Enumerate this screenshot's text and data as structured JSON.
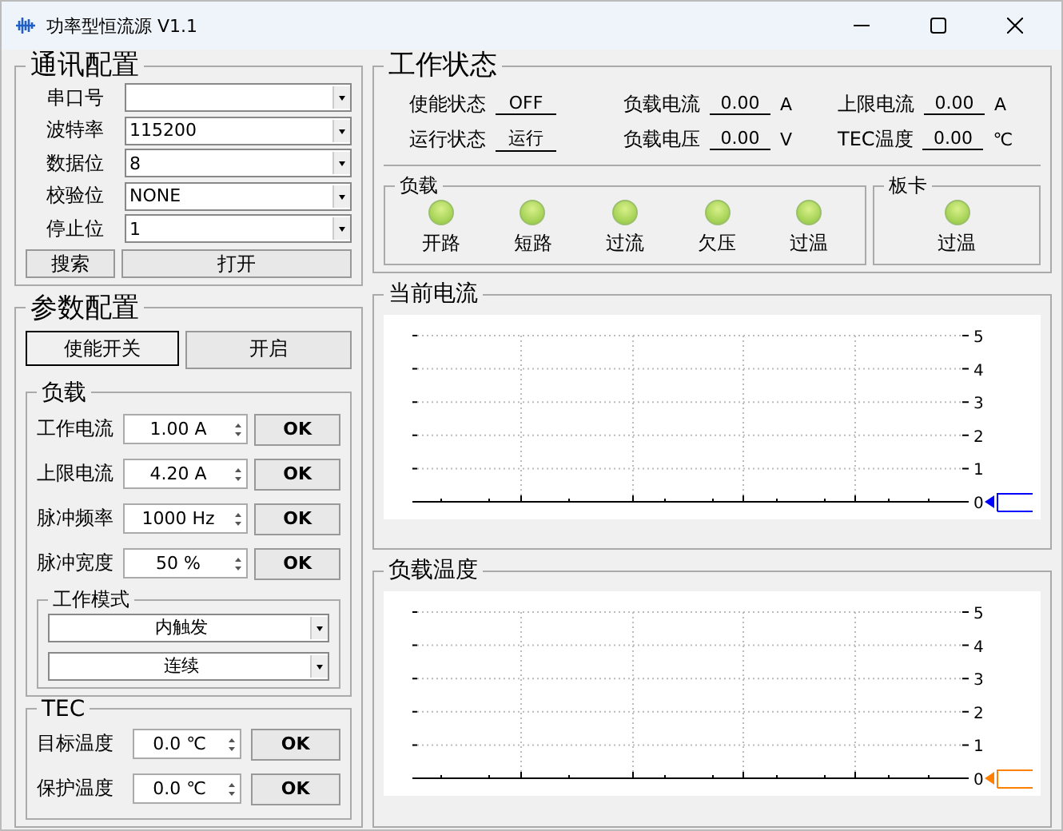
{
  "window": {
    "title": "功率型恒流源 V1.1"
  },
  "comm": {
    "title": "通讯配置",
    "fields": [
      {
        "label": "串口号"
      },
      {
        "label": "波特率",
        "value": "115200"
      },
      {
        "label": "数据位",
        "value": "8"
      },
      {
        "label": "校验位",
        "value": "NONE"
      },
      {
        "label": "停止位",
        "value": "1"
      }
    ],
    "buttons": [
      "搜索",
      "打开"
    ]
  },
  "params": {
    "title": "参数配置",
    "switch_label": "使能开关",
    "switch_button": "开启",
    "load": {
      "title": "负载",
      "rows": [
        {
          "label": "工作电流",
          "value": "1.00 A",
          "button": "OK"
        },
        {
          "label": "上限电流",
          "value": "4.20 A",
          "button": "OK"
        },
        {
          "label": "脉冲频率",
          "value": "1000 Hz",
          "button": "OK"
        },
        {
          "label": "脉冲宽度",
          "value": "50 %",
          "button": "OK"
        }
      ],
      "mode": {
        "title": "工作模式",
        "options": [
          "内触发",
          "连续"
        ]
      }
    },
    "tec": {
      "title": "TEC",
      "rows": [
        {
          "label": "目标温度",
          "value": "0.0 ℃",
          "button": "OK"
        },
        {
          "label": "保护温度",
          "value": "0.0 ℃",
          "button": "OK"
        }
      ]
    }
  },
  "status": {
    "title": "工作状态",
    "readings": [
      {
        "label": "使能状态",
        "value": "OFF"
      },
      {
        "label": "负载电流",
        "value": "0.00",
        "unit": "A"
      },
      {
        "label": "上限电流",
        "value": "0.00",
        "unit": "A"
      },
      {
        "label": "运行状态",
        "value": "运行"
      },
      {
        "label": "负载电压",
        "value": "0.00",
        "unit": "V"
      },
      {
        "label": "TEC温度",
        "value": "0.00",
        "unit": "℃"
      }
    ],
    "groups": [
      {
        "title": "负载",
        "lamps": [
          {
            "label": "开路",
            "on": true
          },
          {
            "label": "短路",
            "on": true
          },
          {
            "label": "过流",
            "on": true
          },
          {
            "label": "欠压",
            "on": true
          },
          {
            "label": "过温",
            "on": true
          }
        ]
      },
      {
        "title": "板卡",
        "lamps": [
          {
            "label": "过温",
            "on": true
          }
        ]
      }
    ]
  },
  "charts": [
    {
      "title": "当前电流",
      "color": "#0000ff",
      "y_labels": [
        "5",
        "4",
        "3",
        "2",
        "1",
        "0"
      ]
    },
    {
      "title": "负载温度",
      "color": "#ff8000",
      "y_labels": [
        "5",
        "4",
        "3",
        "2",
        "1",
        "0"
      ]
    }
  ]
}
